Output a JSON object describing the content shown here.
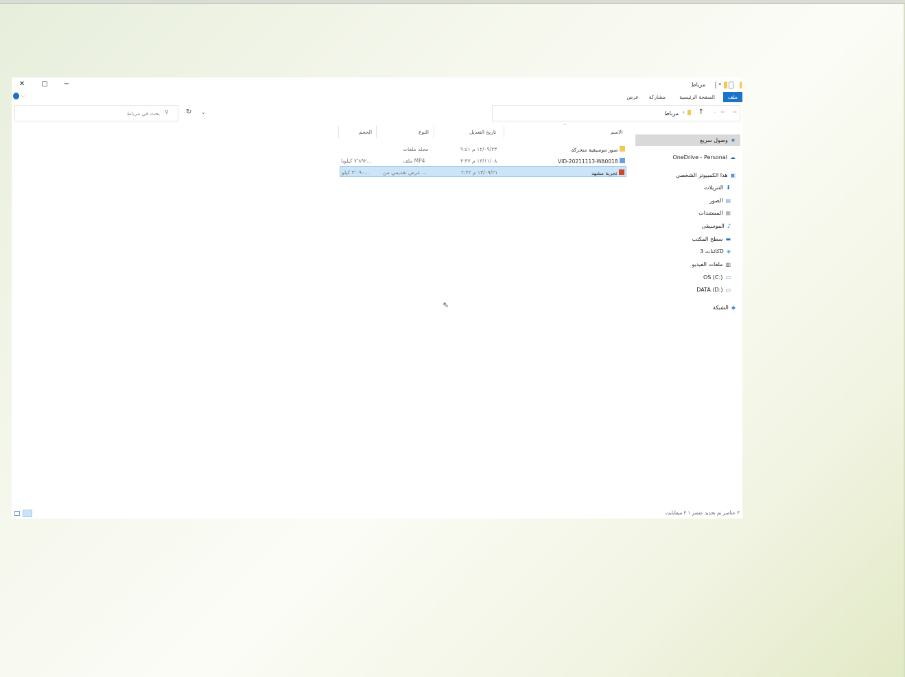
{
  "window": {
    "title": "مرباط",
    "controls": {
      "minimize": "−",
      "maximize": "▢",
      "close": "✕"
    }
  },
  "ribbon": {
    "tabs": [
      {
        "label": "ملف",
        "active": true
      },
      {
        "label": "الصفحة الرئيسية"
      },
      {
        "label": "مشاركة"
      },
      {
        "label": "عرض"
      }
    ]
  },
  "address": {
    "path": "مرباط",
    "separator": "›"
  },
  "search": {
    "placeholder": "بحث في مرباط"
  },
  "nav": {
    "quick_access": "وصول سريع",
    "onedrive": "OneDrive - Personal",
    "this_pc": "هذا الكمبيوتر الشخصي",
    "items": [
      {
        "label": "التنزيلات",
        "icon": "download-icon"
      },
      {
        "label": "الصور",
        "icon": "pictures-icon"
      },
      {
        "label": "المستندات",
        "icon": "documents-icon"
      },
      {
        "label": "الموسيقى",
        "icon": "music-icon"
      },
      {
        "label": "سطح المكتب",
        "icon": "desktop-icon"
      },
      {
        "label": "كائنات 3D",
        "icon": "objects3d-icon"
      },
      {
        "label": "ملفات الفيديو",
        "icon": "video-icon"
      },
      {
        "label": "OS (C:)",
        "icon": "drive-c-icon"
      },
      {
        "label": "DATA (D:)",
        "icon": "drive-d-icon"
      }
    ],
    "network": "الشبكة"
  },
  "columns": {
    "name": "الاسم",
    "date": "تاريخ التعديل",
    "type": "النوع",
    "size": "الحجم"
  },
  "files": [
    {
      "name": "صور موسيقية متحركة",
      "date": "١٢/٠٩/٢٣ م ٩:٤١",
      "type": "مجلد ملفات",
      "size": ""
    },
    {
      "name": "VID-20211113-WA0018",
      "date": "١٣/١١/٠٨ م ٣:٣٧",
      "type": "ملف MP4",
      "size": "٧٬٨٩٢ كيلوبا..."
    },
    {
      "name": "تجربة مشهد",
      "date": "١٣/٠٩/٢١ م ٢:٣٢",
      "type": "عرض تقديمي من ...",
      "size": "٣٬٠٩٠ كيلو..."
    }
  ],
  "status": {
    "text": "٣ عناصر    تم تحديد عنصر ١   ٣ ميغابايت"
  },
  "colors": {
    "accent": "#1a73c7",
    "selection": "#cce4f7",
    "folder": "#f2c94c"
  }
}
